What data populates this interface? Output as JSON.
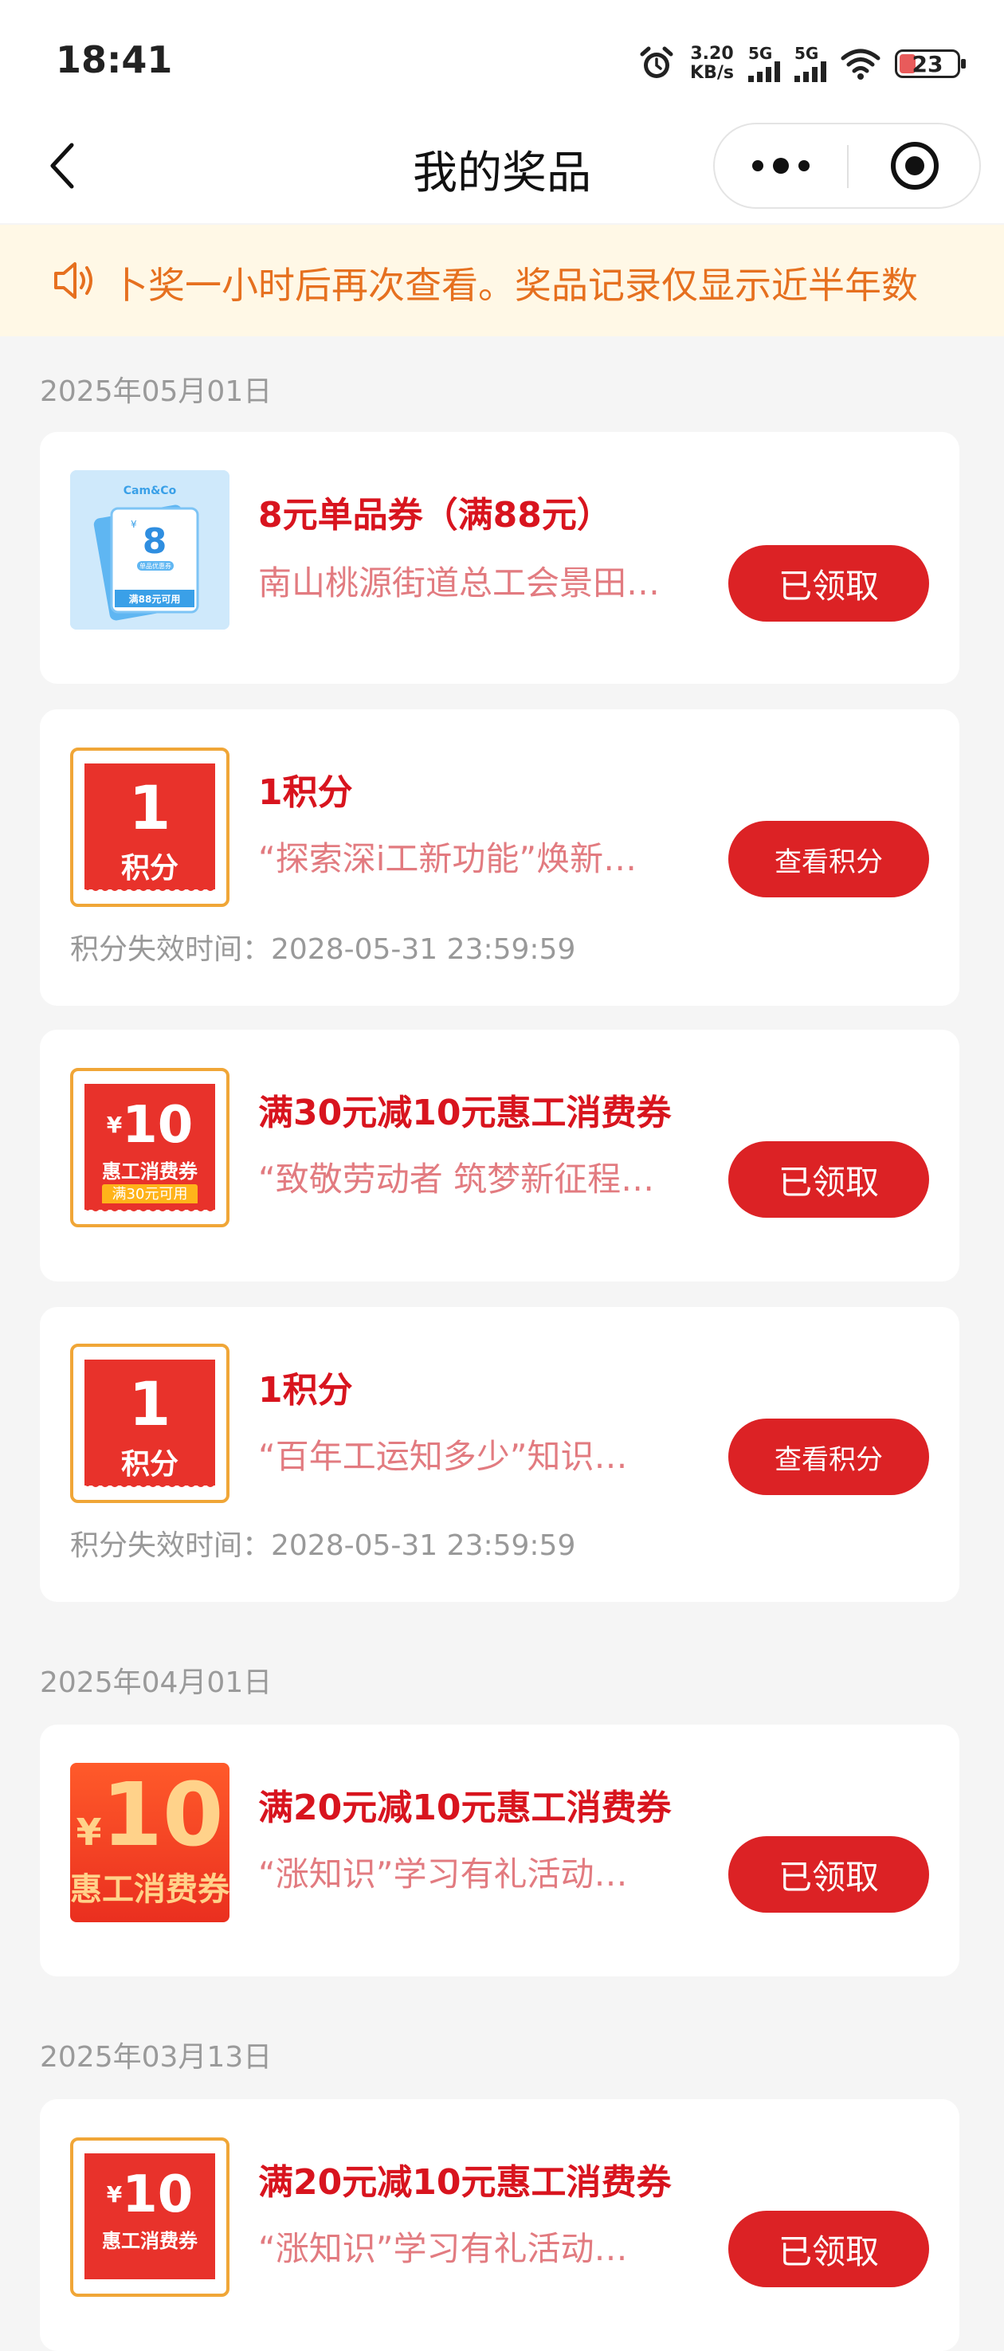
{
  "status": {
    "time": "18:41",
    "net_speed": "3.20",
    "net_unit": "KB/s",
    "sim1": "5G",
    "sim2": "5G",
    "battery": "23"
  },
  "nav": {
    "title": "我的奖品"
  },
  "notice": {
    "text": "卜奖一小时后再次查看。奖品记录仅显示近半年数"
  },
  "groups": [
    {
      "date": "2025年05月01日"
    },
    {
      "date": "2025年04月01日"
    },
    {
      "date": "2025年03月13日"
    }
  ],
  "prizes": [
    {
      "title": "8元单品券（满88元）",
      "desc": "南山桃源街道总工会景田…",
      "button": "已领取",
      "thumb": {
        "brand": "Cam&Co",
        "value": "8",
        "currency": "¥",
        "line1": "单品优惠券",
        "line2": "满88元可用"
      }
    },
    {
      "title": "1积分",
      "desc": "“探索深i工新功能”焕新…",
      "button": "查看积分",
      "expiry": "积分失效时间：2028-05-31 23:59:59",
      "thumb": {
        "num": "1",
        "unit": "积分"
      }
    },
    {
      "title": "满30元减10元惠工消费券",
      "desc": "“致敬劳动者 筑梦新征程…",
      "button": "已领取",
      "thumb": {
        "currency": "¥",
        "value": "10",
        "name": "惠工消费券",
        "tag": "满30元可用"
      }
    },
    {
      "title": "1积分",
      "desc": "“百年工运知多少”知识…",
      "button": "查看积分",
      "expiry": "积分失效时间：2028-05-31 23:59:59",
      "thumb": {
        "num": "1",
        "unit": "积分"
      }
    },
    {
      "title": "满20元减10元惠工消费券",
      "desc": "“涨知识”学习有礼活动…",
      "button": "已领取",
      "thumb": {
        "currency": "¥",
        "value": "10",
        "name": "惠工消费券"
      }
    },
    {
      "title": "满20元减10元惠工消费券",
      "desc": "“涨知识”学习有礼活动…",
      "button": "已领取",
      "thumb": {
        "currency": "¥",
        "value": "10",
        "name": "惠工消费券"
      }
    }
  ]
}
